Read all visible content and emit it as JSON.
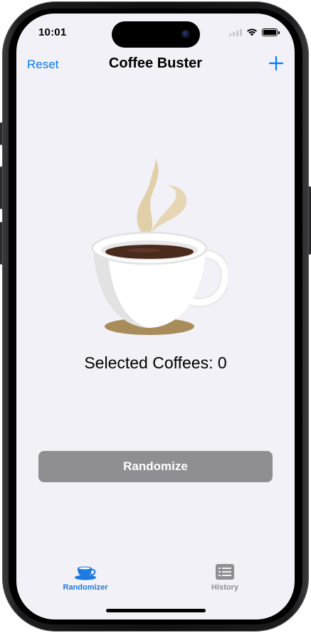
{
  "status_bar": {
    "time": "10:01"
  },
  "nav": {
    "left_button": "Reset",
    "title": "Coffee Buster",
    "right_icon": "plus-icon"
  },
  "main": {
    "illustration": "coffee-cup-illustration",
    "selected_label": "Selected Coffees: 0",
    "randomize_button": "Randomize"
  },
  "tab_bar": {
    "items": [
      {
        "label": "Randomizer",
        "icon": "coffee-cup-icon",
        "selected": true
      },
      {
        "label": "History",
        "icon": "list-icon",
        "selected": false
      }
    ]
  },
  "colors": {
    "accent": "#007aff",
    "tab_selected": "#1d7ae0",
    "tab_unselected": "#8e8e93",
    "button_disabled": "#8e8e93",
    "background": "#f2f1f7",
    "steam": "#e1cfa8",
    "coffee": "#4a2a1c",
    "saucer_shadow": "#a88c5b"
  }
}
